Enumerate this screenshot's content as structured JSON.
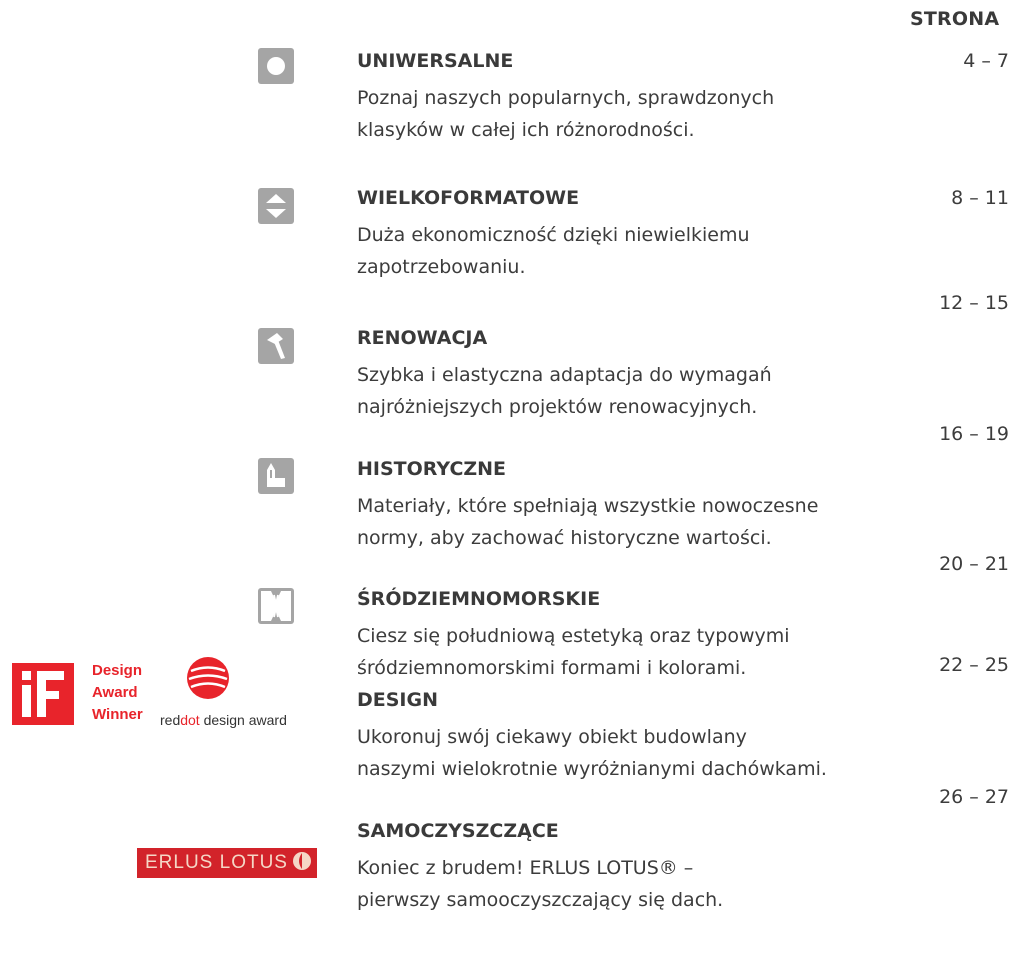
{
  "header": {
    "pages_label": "STRONA"
  },
  "sections": [
    {
      "icon": "circle-icon",
      "title": "UNIWERSALNE",
      "description": [
        "Poznaj naszych popularnych, sprawdzonych",
        "klasyków w całej ich różnorodności."
      ],
      "pages": "4 – 7"
    },
    {
      "icon": "arrows-up-down-icon",
      "title": "WIELKOFORMATOWE",
      "description": [
        "Duża ekonomiczność dzięki niewielkiemu",
        "zapotrzebowaniu."
      ],
      "pages": "8 – 11"
    },
    {
      "icon": "hammer-icon",
      "title": "RENOWACJA",
      "description": [
        "Szybka i elastyczna adaptacja do wymagań",
        "najróżniejszych projektów renowacyjnych."
      ],
      "pages": "12 – 15"
    },
    {
      "icon": "historic-building-icon",
      "title": "HISTORYCZNE",
      "description": [
        "Materiały, które spełniają wszystkie nowoczesne",
        "normy, aby zachować historyczne wartości."
      ],
      "pages": "16 – 19"
    },
    {
      "icon": "mediterranean-tile-icon",
      "title": "ŚRÓDZIEMNOMORSKIE",
      "description": [
        "Ciesz się południową estetyką oraz typowymi",
        "śródziemnomorskimi formami i kolorami."
      ],
      "pages": "20 – 21"
    },
    {
      "icon": "",
      "title": "DESIGN",
      "description": [
        "Ukoronuj swój ciekawy obiekt budowlany",
        "naszymi wielokrotnie wyróżnianymi dachówkami."
      ],
      "pages": "22 – 25"
    },
    {
      "icon": "",
      "title": "SAMOCZYSZCZĄCE",
      "description": [
        "Koniec z brudem! ERLUS LOTUS® –",
        "pierwszy samooczyszczający się dach."
      ],
      "pages": "26 – 27"
    }
  ],
  "awards": {
    "if_lines": [
      "Design",
      "Award",
      "Winner"
    ],
    "reddot_red": "red",
    "reddot_dot": "dot",
    "reddot_rest": " design award",
    "lotus_label": "ERLUS LOTUS"
  },
  "colors": {
    "icon_gray": "#a5a5a5",
    "award_red": "#e8242b",
    "text": "#3c3c3c"
  }
}
